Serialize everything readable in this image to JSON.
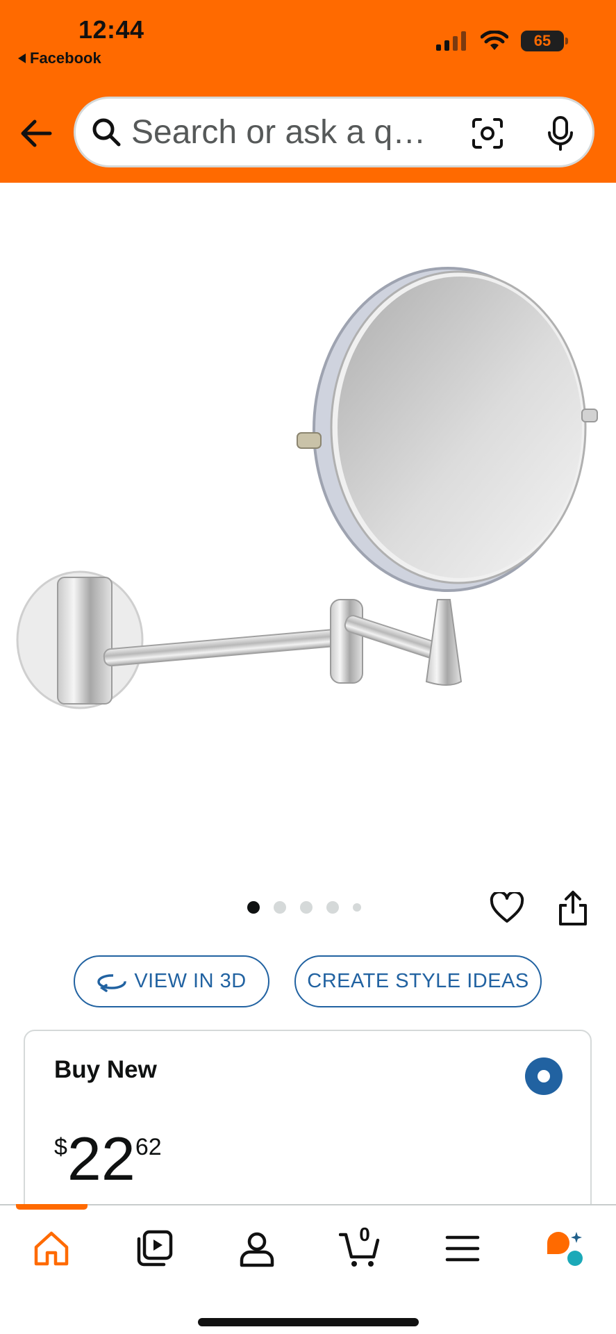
{
  "status_bar": {
    "time": "12:44",
    "back_app": "Facebook",
    "battery": "65"
  },
  "search": {
    "placeholder": "Search or ask a q…"
  },
  "gallery": {
    "image_count": 5,
    "active_index": 0
  },
  "actions": {
    "view_3d": "VIEW IN 3D",
    "style_ideas": "CREATE STYLE IDEAS"
  },
  "offer": {
    "title": "Buy New",
    "price_currency": "$",
    "price_whole": "22",
    "price_fraction": "62"
  },
  "bottom_nav": {
    "items": [
      "home-icon",
      "video-icon",
      "account-icon",
      "cart-icon",
      "menu-icon",
      "rufus-icon"
    ],
    "cart_count": "0",
    "active": "home"
  },
  "colors": {
    "header": "#ff6a00",
    "link": "#2162a1",
    "accent": "#ff6a00"
  }
}
